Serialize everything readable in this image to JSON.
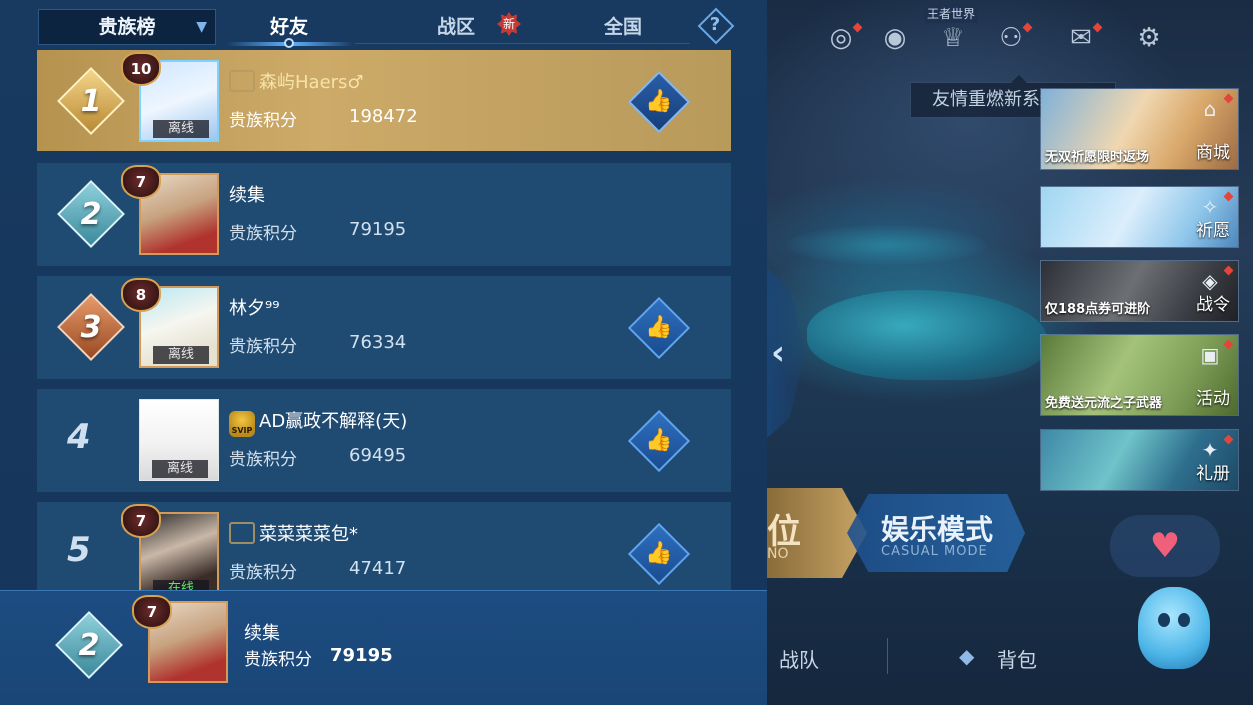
{
  "tabs": {
    "dropdown_label": "贵族榜",
    "friends": "好友",
    "zone": "战区",
    "zone_badge": "新",
    "nation": "全国",
    "help": "?"
  },
  "leaderboard": [
    {
      "rank": "1",
      "level": "10",
      "name": "森屿Haers♂",
      "status": "离线",
      "score_label": "贵族积分",
      "score": "198472",
      "liked_button": true
    },
    {
      "rank": "2",
      "level": "7",
      "name": "续集",
      "status": "",
      "score_label": "贵族积分",
      "score": "79195",
      "liked_button": false
    },
    {
      "rank": "3",
      "level": "8",
      "name": "林夕⁹⁹",
      "status": "离线",
      "score_label": "贵族积分",
      "score": "76334",
      "liked_button": true
    },
    {
      "rank": "4",
      "level": "",
      "name": "AD赢政不解释(天)",
      "status": "离线",
      "score_label": "贵族积分",
      "score": "69495",
      "liked_button": true
    },
    {
      "rank": "5",
      "level": "7",
      "name": "菜菜菜菜包*",
      "status": "在线",
      "score_label": "贵族积分",
      "score": "47417",
      "liked_button": true
    }
  ],
  "self": {
    "rank": "2",
    "level": "7",
    "name": "续集",
    "score_label": "贵族积分",
    "score": "79195"
  },
  "top_icons": [
    "target-icon",
    "eye-icon",
    "trophy-icon",
    "friends-icon",
    "mail-icon",
    "gear-icon"
  ],
  "world_label": "王者世界",
  "notice": "友情重燃新系统上线",
  "menu_cards": [
    {
      "label": "商城",
      "caption": "无双祈愿限时返场"
    },
    {
      "label": "祈愿",
      "caption": ""
    },
    {
      "label": "战令",
      "caption": "仅188点券可进阶"
    },
    {
      "label": "活动",
      "caption": "免费送元流之子武器"
    },
    {
      "label": "礼册",
      "caption": ""
    }
  ],
  "modes": {
    "left_title": "位",
    "left_sub": "NO",
    "right_title": "娱乐模式",
    "right_sub": "CASUAL MODE"
  },
  "bottom_nav": {
    "team": "战队",
    "bag": "背包"
  },
  "colors": {
    "panel_bg": "#16355a",
    "row_bg": "#1f4a72",
    "gold_row": "#cdaa68",
    "accent_blue": "#5fb3ff",
    "online_green": "#62e56a",
    "badge_red": "#c73a33"
  }
}
